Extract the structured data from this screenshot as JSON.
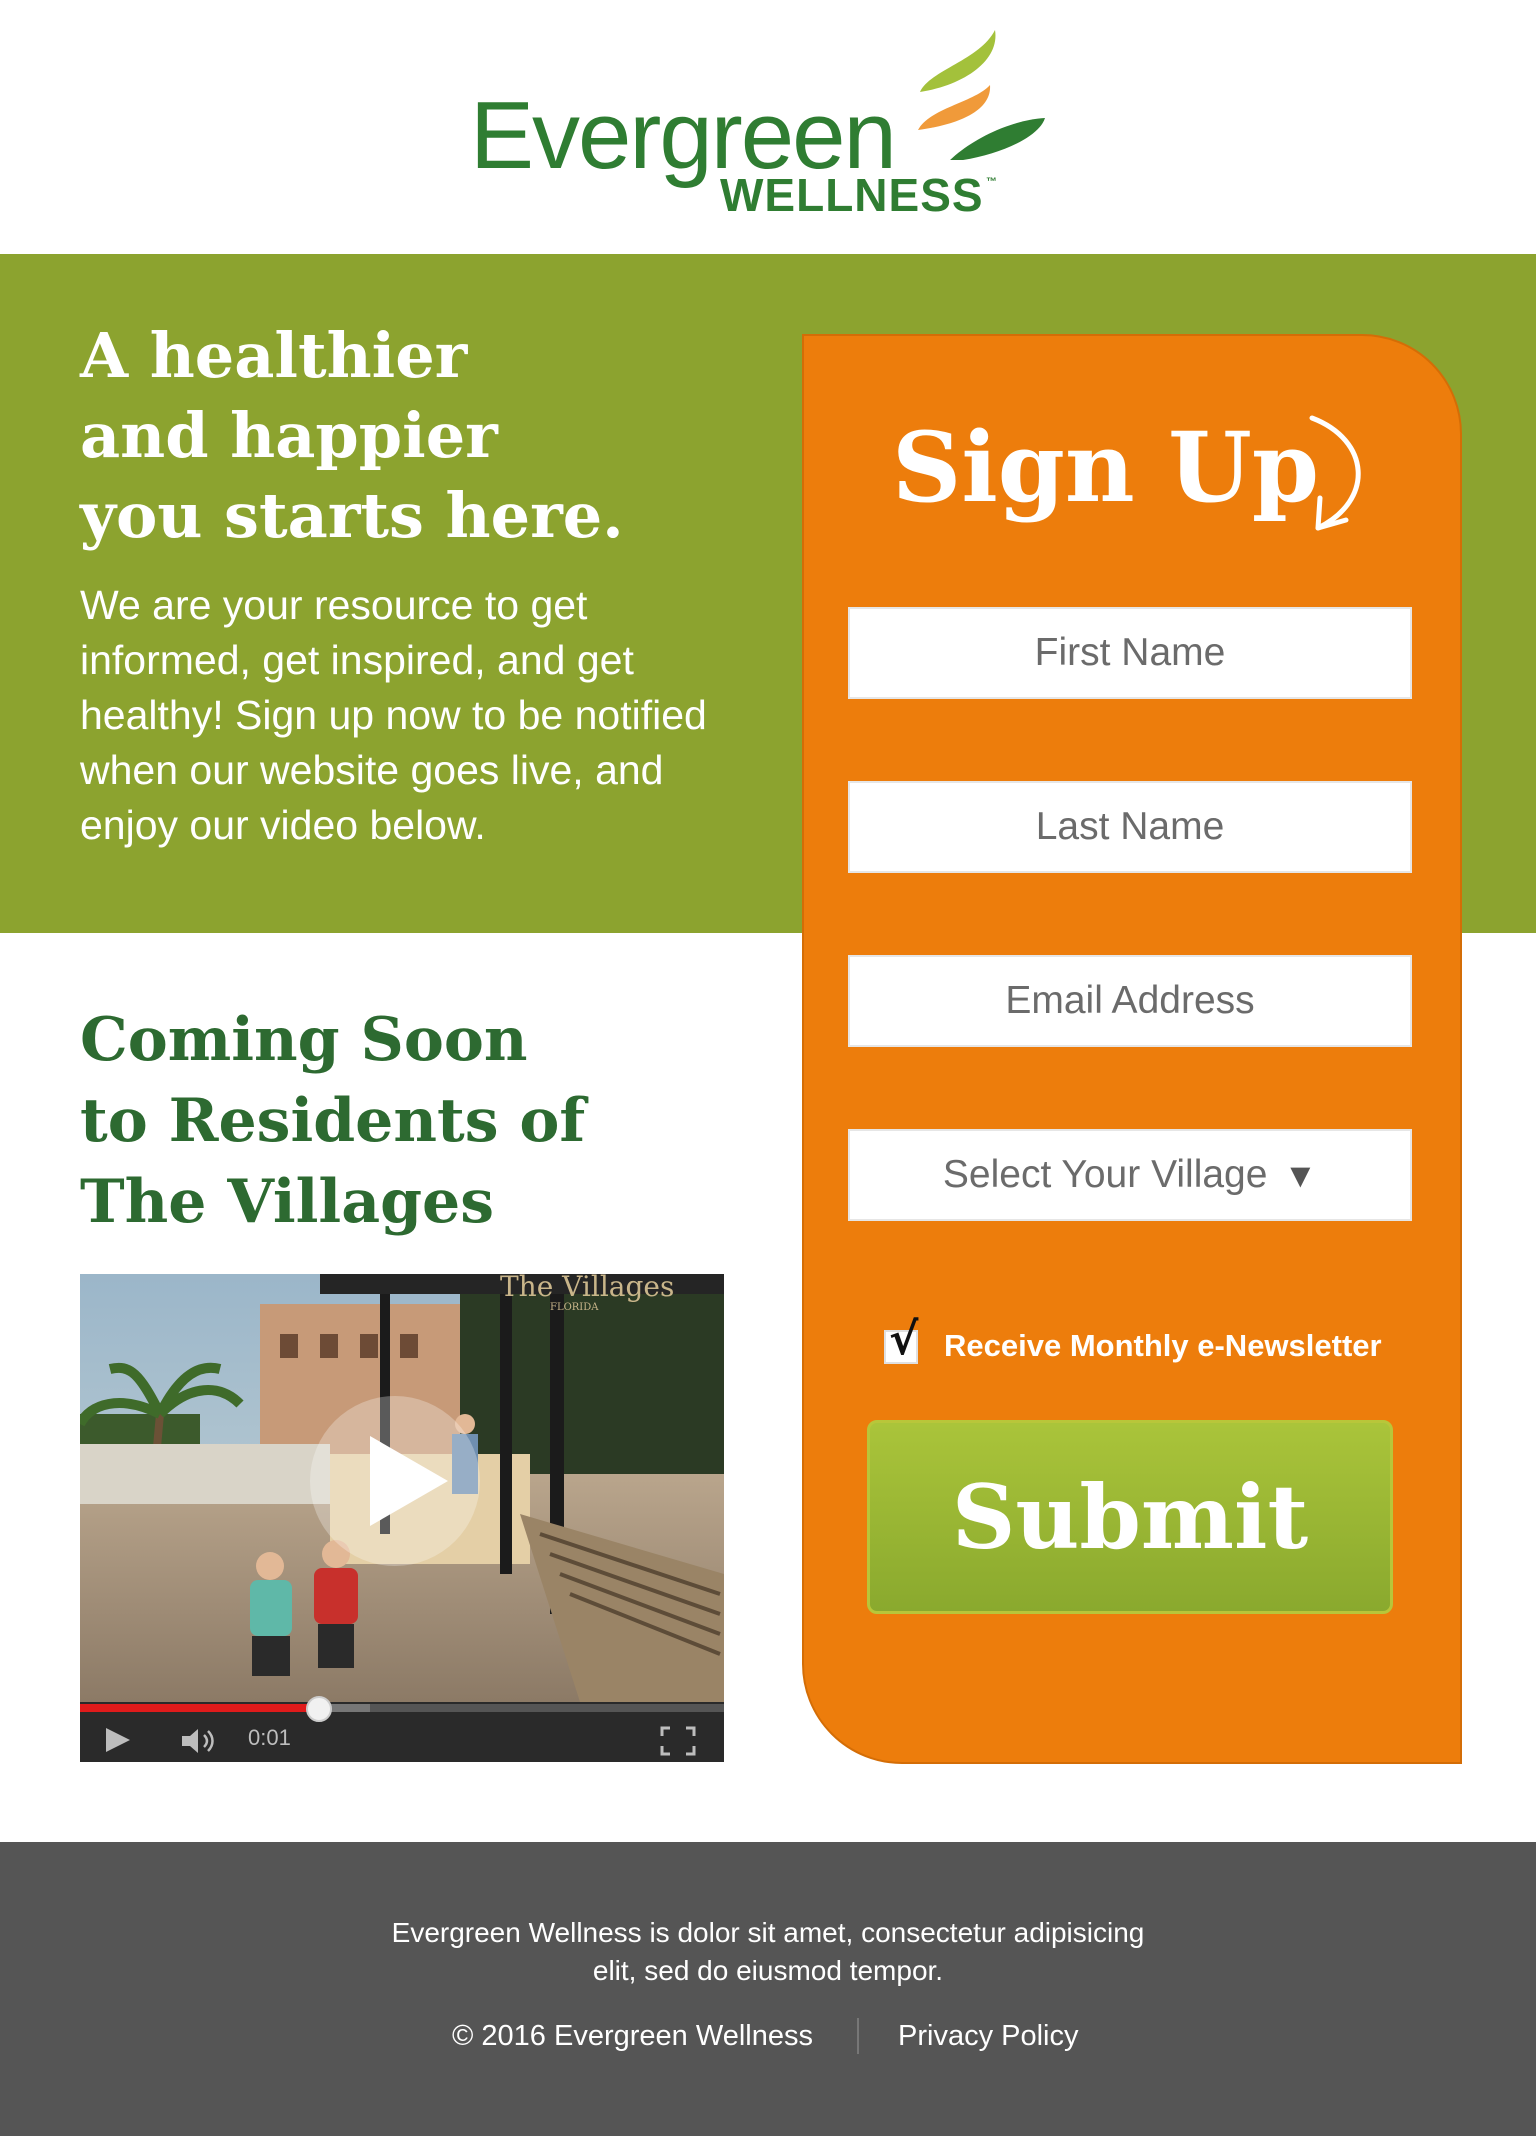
{
  "logo": {
    "word": "Evergreen",
    "sub": "WELLNESS",
    "tm": "™"
  },
  "hero": {
    "title_lines": [
      "A healthier",
      "and happier",
      "you starts here."
    ],
    "text": "We are your resource to get informed, get inspired, and get healthy! Sign up now to be notified when our website goes live, and enjoy our video below."
  },
  "coming_soon": {
    "lines": [
      "Coming Soon",
      "to Residents of",
      "The Villages"
    ]
  },
  "video": {
    "time": "0:01",
    "progress": 0.37,
    "buffered": 0.45,
    "sign_text": "The Villages",
    "sign_sub": "FLORIDA"
  },
  "signup": {
    "title": "Sign Up",
    "first_name_placeholder": "First Name",
    "last_name_placeholder": "Last Name",
    "email_placeholder": "Email Address",
    "village_select": "Select Your Village",
    "village_arrow": "▼",
    "newsletter_checked": true,
    "newsletter_label": "Receive Monthly e-Newsletter",
    "check_glyph": "√",
    "submit_label": "Submit"
  },
  "footer": {
    "text": "Evergreen Wellness is dolor sit amet, consectetur adipisicing elit, sed do eiusmod tempor.",
    "copyright": "© 2016 Evergreen Wellness",
    "privacy": "Privacy Policy"
  },
  "colors": {
    "brand_green": "#2f7d32",
    "band_green": "#8ca32f",
    "orange": "#ed7d0c",
    "submit_green": "#8aa92e",
    "footer_gray": "#555555"
  }
}
